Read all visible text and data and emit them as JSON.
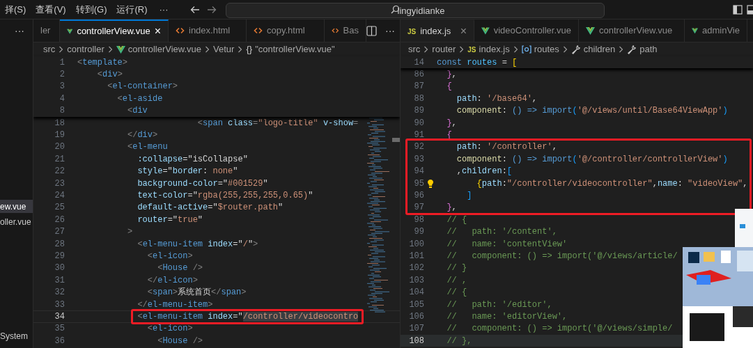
{
  "menu_bar": {
    "items": [
      "择(S)",
      "查看(V)",
      "转到(G)",
      "运行(R)"
    ],
    "more": "···"
  },
  "search": {
    "value": "lingyidianke"
  },
  "sidebar": {
    "more": "···",
    "items": [
      {
        "label": "ew.vue",
        "selected": true
      },
      {
        "label": "oller.vue",
        "selected": false
      },
      {
        "label": "System",
        "selected": false
      }
    ]
  },
  "editors": [
    {
      "focused": true,
      "more": "···",
      "tabs": [
        {
          "label": "ler",
          "kind": "plain",
          "selected": false
        },
        {
          "label": "controllerView.vue",
          "kind": "vue",
          "selected": true,
          "close": "×"
        },
        {
          "label": "index.html",
          "kind": "html",
          "selected": false
        },
        {
          "label": "copy.html",
          "kind": "html",
          "selected": false
        },
        {
          "label": "Bas",
          "kind": "html",
          "selected": false
        }
      ],
      "breadcrumb": [
        {
          "label": "src",
          "kind": "plain"
        },
        {
          "label": "controller",
          "kind": "plain"
        },
        {
          "label": "controllerView.vue",
          "kind": "vue"
        },
        {
          "label": "Vetur",
          "kind": "plain"
        },
        {
          "label": "\"controllerView.vue\"",
          "kind": "symbol",
          "symbol": "{}"
        }
      ],
      "sticky_lines": [
        {
          "number": "1",
          "current": false,
          "tokens": [
            {
              "kind": "punct",
              "text": "<"
            },
            {
              "kind": "tag",
              "text": "template"
            },
            {
              "kind": "punct",
              "text": ">"
            }
          ]
        },
        {
          "number": "2",
          "current": false,
          "tokens": [
            {
              "kind": "punct",
              "text": "    <"
            },
            {
              "kind": "tag",
              "text": "div"
            },
            {
              "kind": "punct",
              "text": ">"
            }
          ]
        },
        {
          "number": "3",
          "current": false,
          "tokens": [
            {
              "kind": "punct",
              "text": "      <"
            },
            {
              "kind": "tag",
              "text": "el-container"
            },
            {
              "kind": "punct",
              "text": ">"
            }
          ]
        },
        {
          "number": "4",
          "current": false,
          "tokens": [
            {
              "kind": "punct",
              "text": "        <"
            },
            {
              "kind": "tag",
              "text": "el-aside"
            }
          ]
        },
        {
          "number": "8",
          "current": false,
          "tokens": [
            {
              "kind": "punct",
              "text": "          <"
            },
            {
              "kind": "tag",
              "text": "div"
            }
          ]
        }
      ],
      "lines": [
        {
          "number": "18",
          "current": false,
          "tokens": [
            {
              "kind": "punct",
              "text": "                        <"
            },
            {
              "kind": "tag",
              "text": "span"
            },
            {
              "kind": "attr",
              "text": " class"
            },
            {
              "kind": "punct",
              "text": "="
            },
            {
              "kind": "str",
              "text": "\"logo-title\""
            },
            {
              "kind": "attr",
              "text": " v-show"
            },
            {
              "kind": "punct",
              "text": "="
            }
          ]
        },
        {
          "number": "19",
          "current": false,
          "tokens": [
            {
              "kind": "punct",
              "text": "          </"
            },
            {
              "kind": "tag",
              "text": "div"
            },
            {
              "kind": "punct",
              "text": ">"
            }
          ]
        },
        {
          "number": "20",
          "current": false,
          "tokens": [
            {
              "kind": "punct",
              "text": "          <"
            },
            {
              "kind": "tag",
              "text": "el-menu"
            }
          ]
        },
        {
          "number": "21",
          "current": false,
          "tokens": [
            {
              "kind": "attr",
              "text": "            :collapse"
            },
            {
              "kind": "text",
              "text": "=\"isCollapse\""
            }
          ]
        },
        {
          "number": "22",
          "current": false,
          "tokens": [
            {
              "kind": "attr",
              "text": "            style"
            },
            {
              "kind": "text",
              "text": "=\""
            },
            {
              "kind": "attr",
              "text": "border"
            },
            {
              "kind": "text",
              "text": ": "
            },
            {
              "kind": "str",
              "text": "none"
            },
            {
              "kind": "text",
              "text": "\""
            }
          ]
        },
        {
          "number": "23",
          "current": false,
          "tokens": [
            {
              "kind": "attr",
              "text": "            background-color"
            },
            {
              "kind": "text",
              "text": "=\""
            },
            {
              "kind": "str",
              "text": "#001529"
            },
            {
              "kind": "text",
              "text": "\""
            }
          ]
        },
        {
          "number": "24",
          "current": false,
          "tokens": [
            {
              "kind": "attr",
              "text": "            text-color"
            },
            {
              "kind": "text",
              "text": "=\""
            },
            {
              "kind": "str",
              "text": "rgba(255,255,255,0.65)"
            },
            {
              "kind": "text",
              "text": "\""
            }
          ]
        },
        {
          "number": "25",
          "current": false,
          "tokens": [
            {
              "kind": "attr",
              "text": "            default-active"
            },
            {
              "kind": "text",
              "text": "=\""
            },
            {
              "kind": "str",
              "text": "$router.path"
            },
            {
              "kind": "text",
              "text": "\""
            }
          ]
        },
        {
          "number": "26",
          "current": false,
          "tokens": [
            {
              "kind": "attr",
              "text": "            router"
            },
            {
              "kind": "text",
              "text": "=\""
            },
            {
              "kind": "str",
              "text": "true"
            },
            {
              "kind": "text",
              "text": "\""
            }
          ]
        },
        {
          "number": "27",
          "current": false,
          "tokens": [
            {
              "kind": "punct",
              "text": "          >"
            }
          ]
        },
        {
          "number": "28",
          "current": false,
          "tokens": [
            {
              "kind": "punct",
              "text": "            <"
            },
            {
              "kind": "tag",
              "text": "el-menu-item"
            },
            {
              "kind": "attr",
              "text": " index"
            },
            {
              "kind": "text",
              "text": "=\""
            },
            {
              "kind": "str",
              "text": "/"
            },
            {
              "kind": "text",
              "text": "\""
            },
            {
              "kind": "punct",
              "text": ">"
            }
          ]
        },
        {
          "number": "29",
          "current": false,
          "tokens": [
            {
              "kind": "punct",
              "text": "              <"
            },
            {
              "kind": "tag",
              "text": "el-icon"
            },
            {
              "kind": "punct",
              "text": ">"
            }
          ]
        },
        {
          "number": "30",
          "current": false,
          "tokens": [
            {
              "kind": "punct",
              "text": "                <"
            },
            {
              "kind": "tag",
              "text": "House"
            },
            {
              "kind": "punct",
              "text": " />"
            }
          ]
        },
        {
          "number": "31",
          "current": false,
          "tokens": [
            {
              "kind": "punct",
              "text": "              </"
            },
            {
              "kind": "tag",
              "text": "el-icon"
            },
            {
              "kind": "punct",
              "text": ">"
            }
          ]
        },
        {
          "number": "32",
          "current": false,
          "tokens": [
            {
              "kind": "punct",
              "text": "              <"
            },
            {
              "kind": "tag",
              "text": "span"
            },
            {
              "kind": "punct",
              "text": ">"
            },
            {
              "kind": "text",
              "text": "系统首页"
            },
            {
              "kind": "punct",
              "text": "</"
            },
            {
              "kind": "tag",
              "text": "span"
            },
            {
              "kind": "punct",
              "text": ">"
            }
          ]
        },
        {
          "number": "33",
          "current": false,
          "tokens": [
            {
              "kind": "punct",
              "text": "            </"
            },
            {
              "kind": "tag",
              "text": "el-menu-item"
            },
            {
              "kind": "punct",
              "text": ">"
            }
          ]
        },
        {
          "number": "34",
          "current": true,
          "tokens": [
            {
              "kind": "punct",
              "text": "            <"
            },
            {
              "kind": "tag",
              "text": "el-menu-item"
            },
            {
              "kind": "attr",
              "text": " index"
            },
            {
              "kind": "text",
              "text": "=\""
            },
            {
              "kind": "str",
              "text": "/controller/videocontro",
              "hl": true
            }
          ]
        },
        {
          "number": "35",
          "current": false,
          "tokens": [
            {
              "kind": "punct",
              "text": "              <"
            },
            {
              "kind": "tag",
              "text": "el-icon"
            },
            {
              "kind": "punct",
              "text": ">"
            }
          ]
        },
        {
          "number": "36",
          "current": false,
          "tokens": [
            {
              "kind": "punct",
              "text": "                <"
            },
            {
              "kind": "tag",
              "text": "House"
            },
            {
              "kind": "punct",
              "text": " />"
            }
          ]
        }
      ]
    },
    {
      "focused": false,
      "tabs": [
        {
          "label": "index.js",
          "kind": "js",
          "symbol": "JS",
          "selected": true,
          "close": "×"
        },
        {
          "label": "videoController.vue",
          "kind": "vue",
          "selected": false
        },
        {
          "label": "controllerView.vue",
          "kind": "vue",
          "selected": false
        },
        {
          "label": "adminVie",
          "kind": "vue",
          "selected": false
        }
      ],
      "breadcrumb": [
        {
          "label": "src",
          "kind": "plain"
        },
        {
          "label": "router",
          "kind": "plain"
        },
        {
          "label": "index.js",
          "kind": "js",
          "symbol": "JS"
        },
        {
          "label": "routes",
          "kind": "variable"
        },
        {
          "label": "children",
          "kind": "wrench"
        },
        {
          "label": "path",
          "kind": "wrench"
        }
      ],
      "sticky_lines": [
        {
          "number": "14",
          "current": false,
          "tokens": [
            {
              "kind": "kw",
              "text": "const"
            },
            {
              "kind": "var",
              "text": " routes"
            },
            {
              "kind": "text",
              "text": " = "
            },
            {
              "kind": "brace1",
              "text": "["
            }
          ]
        }
      ],
      "lines": [
        {
          "number": "86",
          "current": false,
          "tokens": [
            {
              "kind": "brace2",
              "text": "  }"
            },
            {
              "kind": "text",
              "text": ","
            }
          ]
        },
        {
          "number": "87",
          "current": false,
          "tokens": [
            {
              "kind": "brace2",
              "text": "  {"
            }
          ]
        },
        {
          "number": "88",
          "current": false,
          "tokens": [
            {
              "kind": "attr",
              "text": "    path"
            },
            {
              "kind": "text",
              "text": ": "
            },
            {
              "kind": "str",
              "text": "'/base64'"
            },
            {
              "kind": "text",
              "text": ","
            }
          ]
        },
        {
          "number": "89",
          "current": false,
          "tokens": [
            {
              "kind": "fn",
              "text": "    component"
            },
            {
              "kind": "text",
              "text": ": "
            },
            {
              "kind": "kw",
              "text": "() => import"
            },
            {
              "kind": "brace3",
              "text": "("
            },
            {
              "kind": "str",
              "text": "'@/views/until/Base64ViewApp'"
            },
            {
              "kind": "brace3",
              "text": ")"
            }
          ]
        },
        {
          "number": "90",
          "current": false,
          "tokens": [
            {
              "kind": "brace2",
              "text": "  }"
            },
            {
              "kind": "text",
              "text": ","
            }
          ]
        },
        {
          "number": "91",
          "current": false,
          "tokens": [
            {
              "kind": "brace2",
              "text": "  {"
            }
          ]
        },
        {
          "number": "92",
          "current": false,
          "tokens": [
            {
              "kind": "attr",
              "text": "    path"
            },
            {
              "kind": "text",
              "text": ": "
            },
            {
              "kind": "str",
              "text": "'/controller'"
            },
            {
              "kind": "text",
              "text": ","
            }
          ]
        },
        {
          "number": "93",
          "current": false,
          "tokens": [
            {
              "kind": "fn",
              "text": "    component"
            },
            {
              "kind": "text",
              "text": ": "
            },
            {
              "kind": "kw",
              "text": "() => import"
            },
            {
              "kind": "brace3",
              "text": "("
            },
            {
              "kind": "str",
              "text": "'@/controller/controllerView'"
            },
            {
              "kind": "brace3",
              "text": ")"
            }
          ]
        },
        {
          "number": "94",
          "current": false,
          "tokens": [
            {
              "kind": "text",
              "text": "    ,"
            },
            {
              "kind": "attr",
              "text": "children"
            },
            {
              "kind": "text",
              "text": ":"
            },
            {
              "kind": "brace3",
              "text": "["
            }
          ]
        },
        {
          "number": "95",
          "current": false,
          "lightbulb": true,
          "tokens": [
            {
              "kind": "brace1",
              "text": "        {"
            },
            {
              "kind": "attr",
              "text": "path"
            },
            {
              "kind": "text",
              "text": ":"
            },
            {
              "kind": "str",
              "text": "\"/controller/videocontroller\""
            },
            {
              "kind": "text",
              "text": ","
            },
            {
              "kind": "attr",
              "text": "name"
            },
            {
              "kind": "text",
              "text": ": "
            },
            {
              "kind": "str",
              "text": "\"videoView\""
            },
            {
              "kind": "text",
              "text": ","
            }
          ]
        },
        {
          "number": "96",
          "current": false,
          "tokens": [
            {
              "kind": "brace3",
              "text": "      ]"
            }
          ]
        },
        {
          "number": "97",
          "current": false,
          "tokens": [
            {
              "kind": "brace2",
              "text": "  }"
            },
            {
              "kind": "text",
              "text": ","
            }
          ]
        },
        {
          "number": "98",
          "current": false,
          "tokens": [
            {
              "kind": "comment",
              "text": "  // {"
            }
          ]
        },
        {
          "number": "99",
          "current": false,
          "tokens": [
            {
              "kind": "comment",
              "text": "  //   path: '/content',"
            }
          ]
        },
        {
          "number": "100",
          "current": false,
          "tokens": [
            {
              "kind": "comment",
              "text": "  //   name: 'contentView'"
            }
          ]
        },
        {
          "number": "101",
          "current": false,
          "tokens": [
            {
              "kind": "comment",
              "text": "  //   component: () => import('@/views/article/"
            }
          ]
        },
        {
          "number": "102",
          "current": false,
          "tokens": [
            {
              "kind": "comment",
              "text": "  // }"
            }
          ]
        },
        {
          "number": "103",
          "current": false,
          "tokens": [
            {
              "kind": "comment",
              "text": "  // ,"
            }
          ]
        },
        {
          "number": "104",
          "current": false,
          "tokens": [
            {
              "kind": "comment",
              "text": "  // {"
            }
          ]
        },
        {
          "number": "105",
          "current": false,
          "tokens": [
            {
              "kind": "comment",
              "text": "  //   path: '/editor',"
            }
          ]
        },
        {
          "number": "106",
          "current": false,
          "tokens": [
            {
              "kind": "comment",
              "text": "  //   name: 'editorView',"
            }
          ]
        },
        {
          "number": "107",
          "current": false,
          "tokens": [
            {
              "kind": "comment",
              "text": "  //   component: () => import('@/views/simple/"
            }
          ]
        },
        {
          "number": "108",
          "current": true,
          "tokens": [
            {
              "kind": "comment",
              "text": "  // },"
            }
          ]
        }
      ]
    }
  ]
}
